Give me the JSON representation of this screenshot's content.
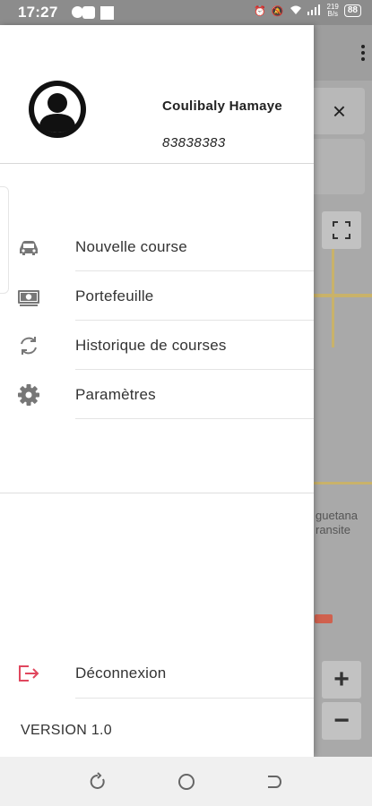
{
  "status_bar": {
    "time": "17:27",
    "net_speed_top": "219",
    "net_speed_bottom": "B/s",
    "battery": "88"
  },
  "user": {
    "name": "Coulibaly Hamaye",
    "phone": "83838383"
  },
  "menu": {
    "items": [
      {
        "label": "Nouvelle course",
        "icon": "car-icon"
      },
      {
        "label": "Portefeuille",
        "icon": "wallet-icon"
      },
      {
        "label": "Historique de courses",
        "icon": "history-icon"
      },
      {
        "label": "Paramètres",
        "icon": "gear-icon"
      }
    ],
    "logout_label": "Déconnexion"
  },
  "version": "VERSION 1.0",
  "map": {
    "label_line1": "guetana",
    "label_line2": "ransite",
    "zoom_in": "+",
    "zoom_out": "−",
    "close": "×"
  },
  "colors": {
    "logout_icon": "#e0475e",
    "icon_gray": "#777777",
    "map_road": "#c9b26a"
  }
}
